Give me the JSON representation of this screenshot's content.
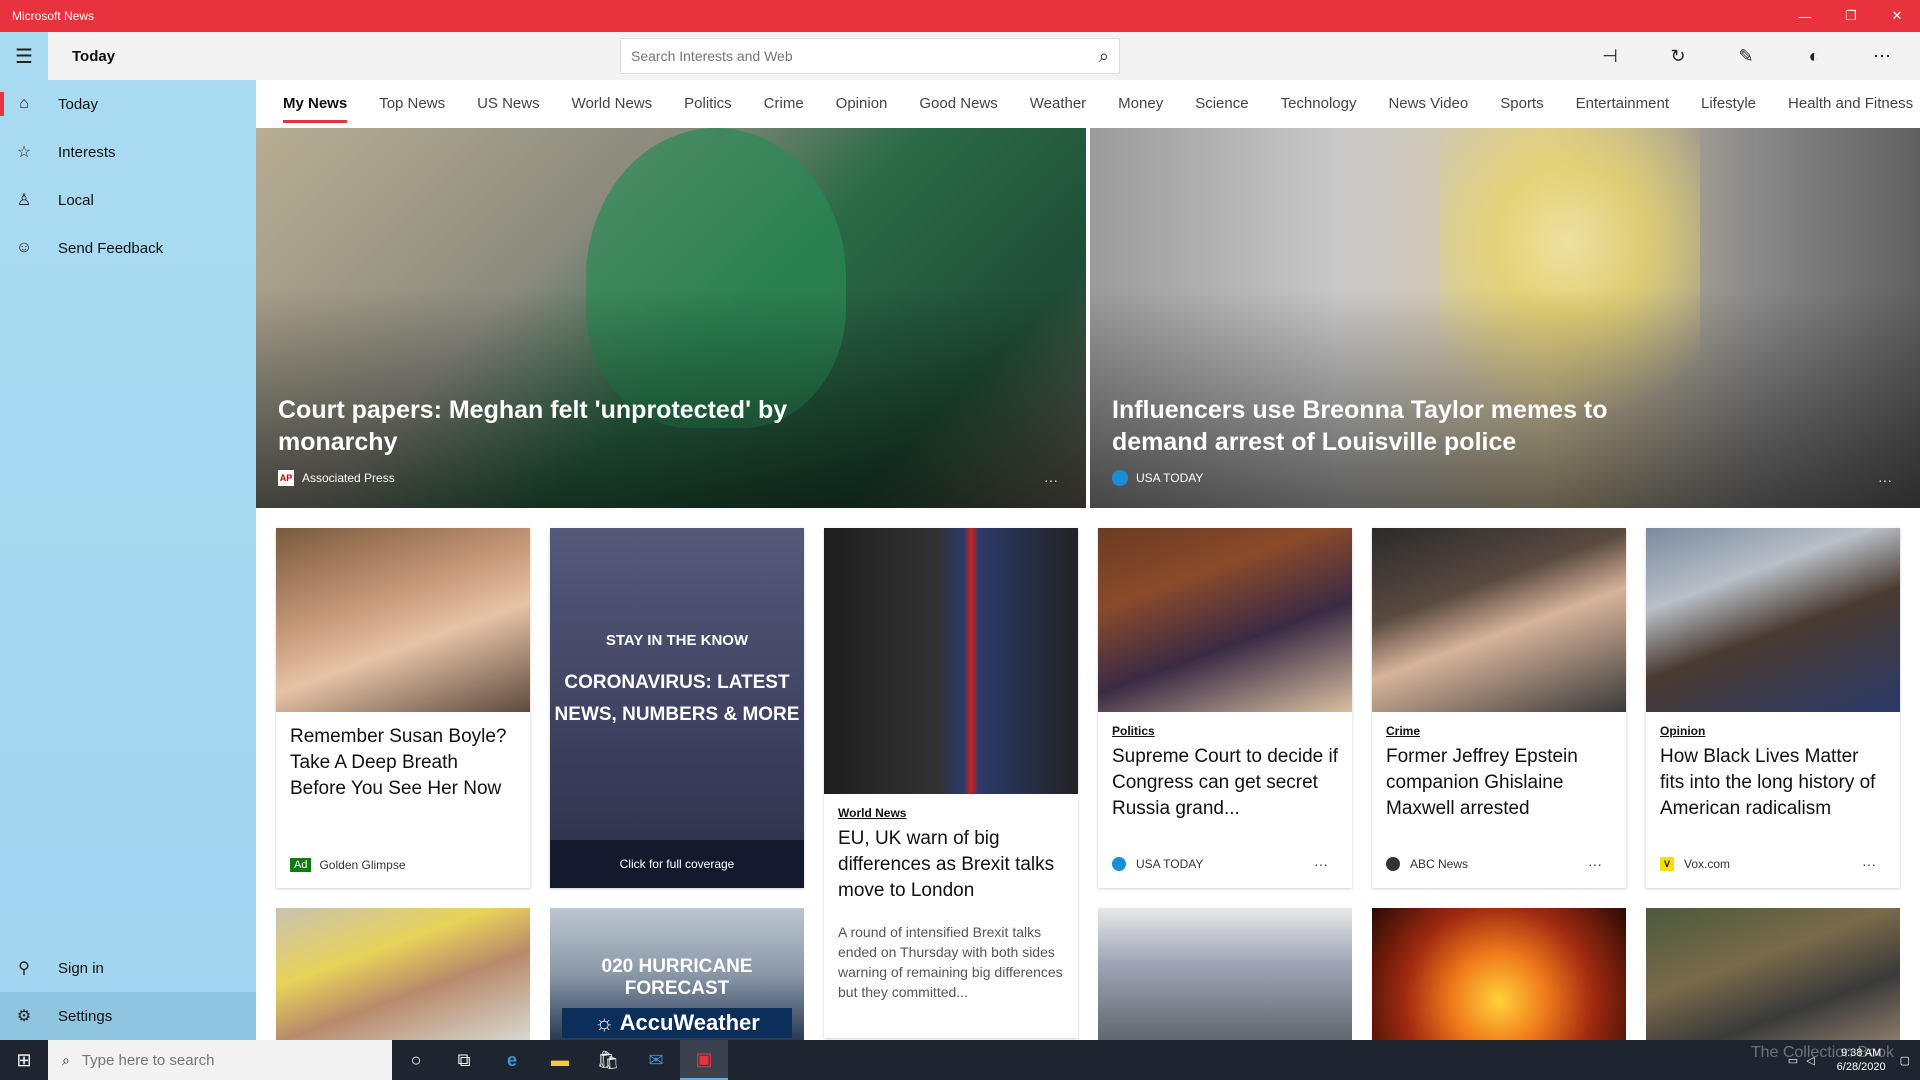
{
  "window": {
    "title": "Microsoft News",
    "min": "—",
    "restore": "❐",
    "close": "✕"
  },
  "header": {
    "title": "Today",
    "search_placeholder": "Search Interests and Web",
    "toolbar": [
      "pin-icon",
      "refresh-icon",
      "edit-icon",
      "dark-mode-icon",
      "more-icon"
    ]
  },
  "sidebar": {
    "items": [
      {
        "label": "Today",
        "icon": "home-icon",
        "active": true
      },
      {
        "label": "Interests",
        "icon": "star-icon"
      },
      {
        "label": "Local",
        "icon": "location-icon"
      },
      {
        "label": "Send Feedback",
        "icon": "smile-icon"
      }
    ],
    "bottom": [
      {
        "label": "Sign in",
        "icon": "person-icon"
      },
      {
        "label": "Settings",
        "icon": "gear-icon"
      }
    ]
  },
  "tabs": [
    "My News",
    "Top News",
    "US News",
    "World News",
    "Politics",
    "Crime",
    "Opinion",
    "Good News",
    "Weather",
    "Money",
    "Science",
    "Technology",
    "News Video",
    "Sports",
    "Entertainment",
    "Lifestyle",
    "Health and Fitness"
  ],
  "hero": [
    {
      "headline": "Court papers: Meghan felt 'unprotected' by monarchy",
      "source": "Associated Press",
      "logo": "AP",
      "more": "···"
    },
    {
      "headline": "Influencers use Breonna Taylor memes to demand arrest of Louisville police",
      "source": "USA TODAY",
      "logo": "",
      "more": "···"
    }
  ],
  "cards": [
    {
      "title": "Remember Susan Boyle? Take A Deep Breath Before You See Her Now",
      "ad": "Ad",
      "source": "Golden Glimpse"
    },
    {
      "kicker": "STAY IN THE KNOW",
      "big": "CORONAVIRUS: LATEST NEWS, NUMBERS & MORE",
      "cta": "Click for full coverage"
    },
    {
      "category": "World News",
      "title": "EU, UK warn of big differences as Brexit talks move to London",
      "summary": "A round of intensified Brexit talks ended on Thursday with both sides warning of remaining big differences but they committed..."
    },
    {
      "category": "Politics",
      "title": "Supreme Court to decide if Congress can get secret Russia grand...",
      "source": "USA TODAY",
      "more": "···"
    },
    {
      "category": "Crime",
      "title": "Former Jeffrey Epstein companion Ghislaine Maxwell arrested",
      "source": "ABC News",
      "more": "···"
    },
    {
      "category": "Opinion",
      "title": "How Black Lives Matter fits into the long history of American radicalism",
      "source": "Vox.com",
      "logo": "V",
      "more": "···"
    }
  ],
  "row2": {
    "hurricane_text": "020 HURRICANE FORECAST",
    "accuweather": "AccuWeather"
  },
  "taskbar": {
    "search_placeholder": "Type here to search",
    "time": "9:38 AM",
    "date": "6/28/2020",
    "watermark": "The Collection Book"
  }
}
